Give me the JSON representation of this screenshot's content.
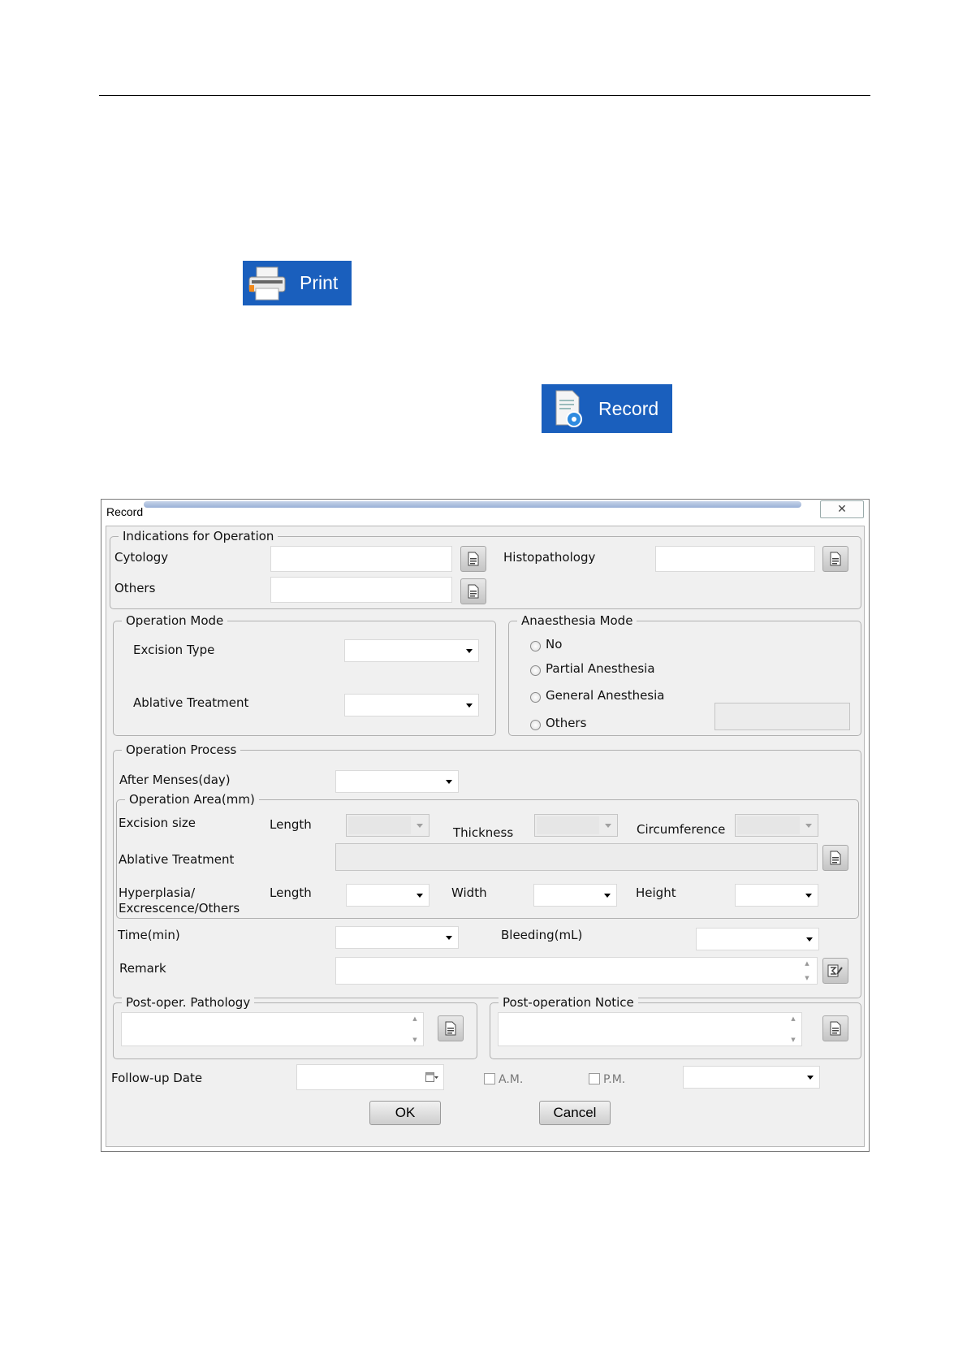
{
  "buttons": {
    "print_label": "Print",
    "record_label": "Record"
  },
  "dialog": {
    "title": "Record",
    "indications": {
      "legend": "Indications for Operation",
      "cytology": "Cytology",
      "histopathology": "Histopathology",
      "others": "Others"
    },
    "operation_mode": {
      "legend": "Operation Mode",
      "excision_type": "Excision Type",
      "ablative_treatment": "Ablative Treatment"
    },
    "anaesthesia": {
      "legend": "Anaesthesia Mode",
      "options": [
        "No",
        "Partial Anesthesia",
        "General Anesthesia",
        "Others"
      ]
    },
    "process": {
      "legend": "Operation Process",
      "after_menses": "After Menses(day)",
      "area_legend": "Operation Area(mm)",
      "excision_size": "Excision size",
      "length": "Length",
      "thickness": "Thickness",
      "circumference": "Circumference",
      "ablative_treatment": "Ablative Treatment",
      "hyperplasia_1": "Hyperplasia/",
      "hyperplasia_2": "Excrescence/Others",
      "width": "Width",
      "height": "Height",
      "time": "Time(min)",
      "bleeding": "Bleeding(mL)",
      "remark": "Remark"
    },
    "post_pathology": {
      "legend": "Post-oper. Pathology"
    },
    "post_notice": {
      "legend": "Post-operation Notice"
    },
    "follow_up": "Follow-up Date",
    "am": "A.M.",
    "pm": "P.M.",
    "ok": "OK",
    "cancel": "Cancel"
  }
}
